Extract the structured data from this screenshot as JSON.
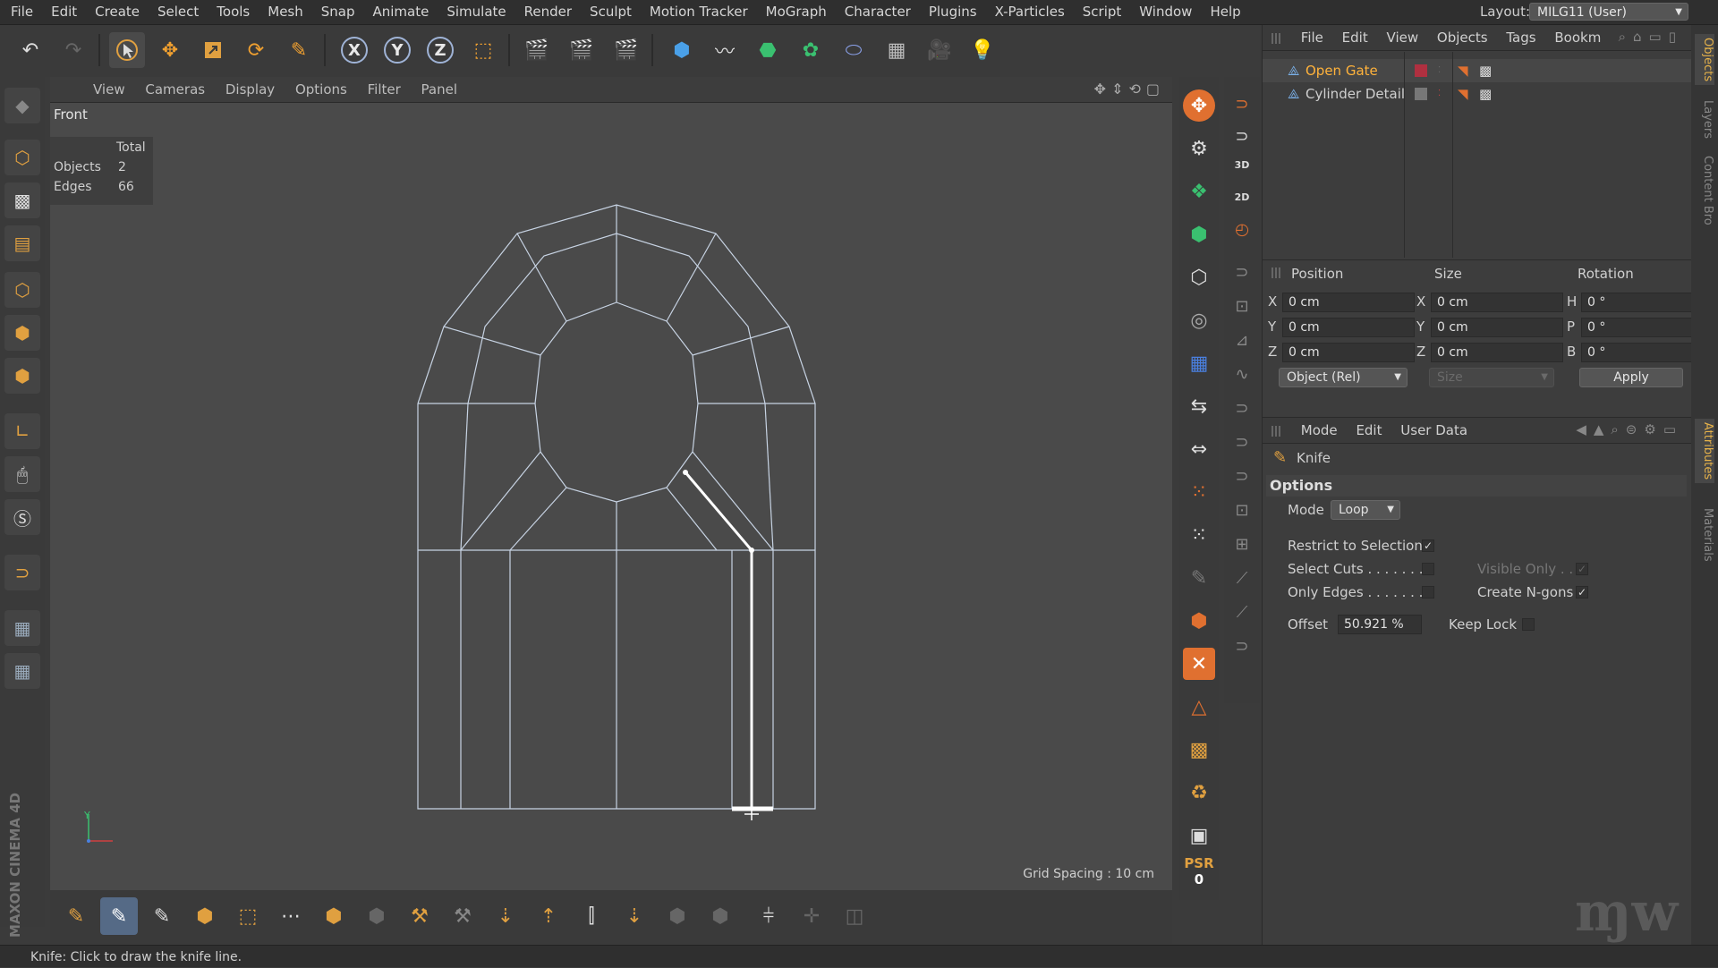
{
  "menu": [
    "File",
    "Edit",
    "Create",
    "Select",
    "Tools",
    "Mesh",
    "Snap",
    "Animate",
    "Simulate",
    "Render",
    "Sculpt",
    "Motion Tracker",
    "MoGraph",
    "Character",
    "Plugins",
    "X-Particles",
    "Script",
    "Window",
    "Help"
  ],
  "layout": {
    "label": "Layout:",
    "value": "MILG11 (User)"
  },
  "top_toolbar": {
    "axis_x": "X",
    "axis_y": "Y",
    "axis_z": "Z"
  },
  "viewport": {
    "menu": [
      "View",
      "Cameras",
      "Display",
      "Options",
      "Filter",
      "Panel"
    ],
    "name": "Front",
    "hud": {
      "header": "Total",
      "objects_label": "Objects",
      "objects_value": "2",
      "edges_label": "Edges",
      "edges_value": "66"
    },
    "grid_spacing": "Grid Spacing : 10 cm",
    "axis_y": "Y"
  },
  "brand": "MAXON CINEMA 4D",
  "status": "Knife: Click to draw the knife line.",
  "strip": {
    "label_3d": "3D",
    "label_2d": "2D",
    "psr": "PSR",
    "psr_value": "0"
  },
  "objects_panel": {
    "menu": [
      "File",
      "Edit",
      "View",
      "Objects",
      "Tags",
      "Bookm"
    ],
    "items": [
      {
        "name": "Open Gate",
        "selected": true
      },
      {
        "name": "Cylinder Detail",
        "selected": false
      }
    ]
  },
  "coordinates": {
    "headers": {
      "position": "Position",
      "size": "Size",
      "rotation": "Rotation"
    },
    "rows": [
      {
        "pos_label": "X",
        "pos": "0 cm",
        "size_label": "X",
        "size": "0 cm",
        "rot_label": "H",
        "rot": "0 °"
      },
      {
        "pos_label": "Y",
        "pos": "0 cm",
        "size_label": "Y",
        "size": "0 cm",
        "rot_label": "P",
        "rot": "0 °"
      },
      {
        "pos_label": "Z",
        "pos": "0 cm",
        "size_label": "Z",
        "size": "0 cm",
        "rot_label": "B",
        "rot": "0 °"
      }
    ],
    "mode_select": "Object (Rel)",
    "size_select": "Size",
    "apply": "Apply"
  },
  "attributes": {
    "menu": [
      "Mode",
      "Edit",
      "User Data"
    ],
    "tool": "Knife",
    "section": "Options",
    "mode_label": "Mode",
    "mode_value": "Loop",
    "restrict": "Restrict to Selection",
    "select_cuts": "Select Cuts . . . . . . .",
    "visible_only": "Visible Only . .",
    "only_edges": "Only Edges . . . . . . .",
    "create_ngons": "Create N-gons",
    "offset_label": "Offset",
    "offset_value": "50.921 %",
    "keep_lock": "Keep Lock"
  },
  "side_tabs": [
    "Objects",
    "Layers",
    "Content Bro",
    "Attributes",
    "Materials"
  ],
  "colors": {
    "accent": "#ffb23b",
    "wire": "#c7d3e3",
    "selection": "#ffffff"
  }
}
